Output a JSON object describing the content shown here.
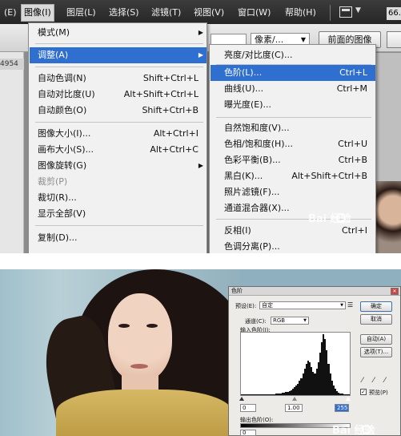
{
  "menubar": {
    "items": [
      {
        "label": "(E)",
        "active": false
      },
      {
        "label": "图像(I)",
        "active": true
      },
      {
        "label": "图层(L)",
        "active": false
      },
      {
        "label": "选择(S)",
        "active": false
      },
      {
        "label": "滤镜(T)",
        "active": false
      },
      {
        "label": "视图(V)",
        "active": false
      },
      {
        "label": "窗口(W)",
        "active": false
      },
      {
        "label": "帮助(H)",
        "active": false
      }
    ],
    "zoom": "66."
  },
  "options_bar": {
    "select_value": "像素/...",
    "button_label": "前面的图像"
  },
  "left_rail": {
    "ruler_text": "4954"
  },
  "image_menu": {
    "items": [
      {
        "label": "模式(M)",
        "shortcut": "",
        "submenu": true,
        "highlighted": false,
        "disabled": false
      },
      {
        "label": "调整(A)",
        "shortcut": "",
        "submenu": true,
        "highlighted": true,
        "disabled": false
      },
      {
        "label": "自动色调(N)",
        "shortcut": "Shift+Ctrl+L",
        "submenu": false,
        "highlighted": false,
        "disabled": false
      },
      {
        "label": "自动对比度(U)",
        "shortcut": "Alt+Shift+Ctrl+L",
        "submenu": false,
        "highlighted": false,
        "disabled": false
      },
      {
        "label": "自动颜色(O)",
        "shortcut": "Shift+Ctrl+B",
        "submenu": false,
        "highlighted": false,
        "disabled": false
      },
      {
        "label": "图像大小(I)...",
        "shortcut": "Alt+Ctrl+I",
        "submenu": false,
        "highlighted": false,
        "disabled": false
      },
      {
        "label": "画布大小(S)...",
        "shortcut": "Alt+Ctrl+C",
        "submenu": false,
        "highlighted": false,
        "disabled": false
      },
      {
        "label": "图像旋转(G)",
        "shortcut": "",
        "submenu": true,
        "highlighted": false,
        "disabled": false
      },
      {
        "label": "裁剪(P)",
        "shortcut": "",
        "submenu": false,
        "highlighted": false,
        "disabled": true
      },
      {
        "label": "裁切(R)...",
        "shortcut": "",
        "submenu": false,
        "highlighted": false,
        "disabled": false
      },
      {
        "label": "显示全部(V)",
        "shortcut": "",
        "submenu": false,
        "highlighted": false,
        "disabled": false
      },
      {
        "label": "复制(D)...",
        "shortcut": "",
        "submenu": false,
        "highlighted": false,
        "disabled": false
      }
    ]
  },
  "adjust_submenu": {
    "items": [
      {
        "label": "亮度/对比度(C)...",
        "shortcut": "",
        "highlighted": false
      },
      {
        "label": "色阶(L)...",
        "shortcut": "Ctrl+L",
        "highlighted": true
      },
      {
        "label": "曲线(U)...",
        "shortcut": "Ctrl+M",
        "highlighted": false
      },
      {
        "label": "曝光度(E)...",
        "shortcut": "",
        "highlighted": false
      },
      {
        "label": "自然饱和度(V)...",
        "shortcut": "",
        "highlighted": false
      },
      {
        "label": "色相/饱和度(H)...",
        "shortcut": "Ctrl+U",
        "highlighted": false
      },
      {
        "label": "色彩平衡(B)...",
        "shortcut": "Ctrl+B",
        "highlighted": false
      },
      {
        "label": "黑白(K)...",
        "shortcut": "Alt+Shift+Ctrl+B",
        "highlighted": false
      },
      {
        "label": "照片滤镜(F)...",
        "shortcut": "",
        "highlighted": false
      },
      {
        "label": "通道混合器(X)...",
        "shortcut": "",
        "highlighted": false
      },
      {
        "label": "反相(I)",
        "shortcut": "Ctrl+I",
        "highlighted": false
      },
      {
        "label": "色调分离(P)...",
        "shortcut": "",
        "highlighted": false
      }
    ]
  },
  "levels_dialog": {
    "title": "色阶",
    "preset_label": "预设(E):",
    "preset_value": "自定",
    "channel_label": "通道(C):",
    "channel_value": "RGB",
    "input_levels_label": "输入色阶(I):",
    "input_black": "0",
    "input_gamma": "1.00",
    "input_white": "255",
    "output_levels_label": "输出色阶(O):",
    "output_black": "0",
    "ok_label": "确定",
    "cancel_label": "取消",
    "auto_label": "自动(A)",
    "options_label": "选项(T)...",
    "preview_label": "预览(P)",
    "preview_checked": true,
    "histogram": [
      1,
      1,
      1,
      1,
      1,
      1,
      1,
      1,
      1,
      1,
      1,
      1,
      1,
      1,
      1,
      1,
      1,
      1,
      1,
      1,
      2,
      2,
      2,
      2,
      3,
      3,
      4,
      4,
      5,
      6,
      8,
      10,
      12,
      14,
      18,
      22,
      28,
      34,
      40,
      44,
      42,
      36,
      30,
      28,
      34,
      42,
      54,
      68,
      78,
      72,
      58,
      40,
      28,
      18,
      12,
      8,
      5,
      3,
      2,
      2,
      1,
      1,
      1,
      1
    ]
  },
  "watermark": {
    "top_text": "Bai 经验",
    "bottom_text": "Bai 经验"
  },
  "colors": {
    "menu_highlight": "#2f6fd0",
    "menubar_bg": "#2e2e2e",
    "menu_bg": "#f1f1f1"
  }
}
